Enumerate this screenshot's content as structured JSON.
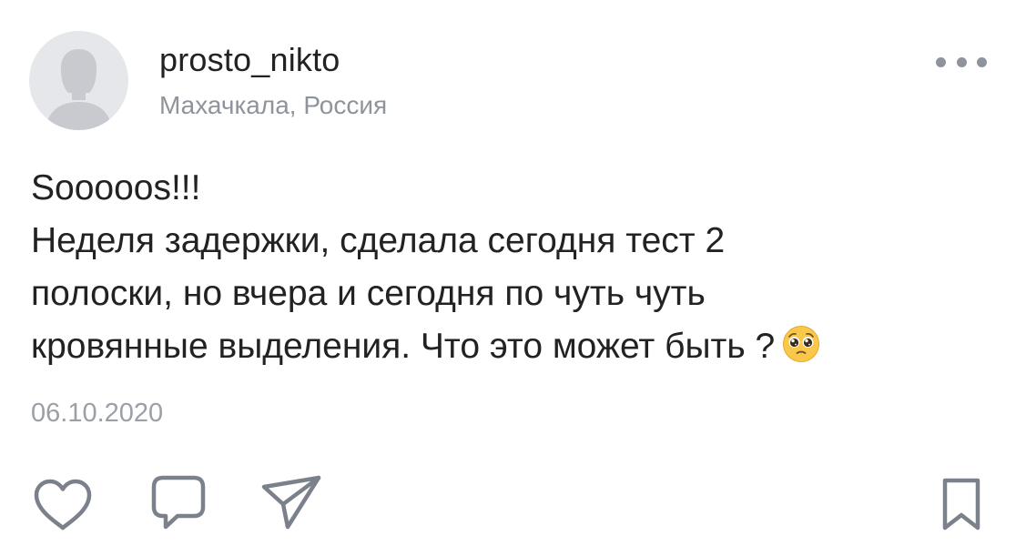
{
  "post": {
    "author": {
      "username": "prosto_nikto",
      "location": "Махачкала, Россия",
      "avatar_icon": "user-silhouette-icon"
    },
    "menu_icon": "more-dots-icon",
    "text_lines": [
      "Sooooos!!!",
      "Неделя задержки, сделала сегодня тест 2",
      "полоски, но вчера и сегодня по чуть чуть",
      "кровянные выделения. Что это может быть ?"
    ],
    "emoji": "pleading-face-emoji",
    "date": "06.10.2020",
    "actions": {
      "like_icon": "heart-icon",
      "comment_icon": "comment-icon",
      "share_icon": "share-icon",
      "bookmark_icon": "bookmark-icon"
    }
  },
  "colors": {
    "text": "#222222",
    "secondary_text": "#8f949c",
    "icon_stroke": "#7b818a",
    "avatar_bg": "#e6e7ea",
    "avatar_figure": "#c8cacf",
    "emoji_face": "#f9c84a"
  }
}
